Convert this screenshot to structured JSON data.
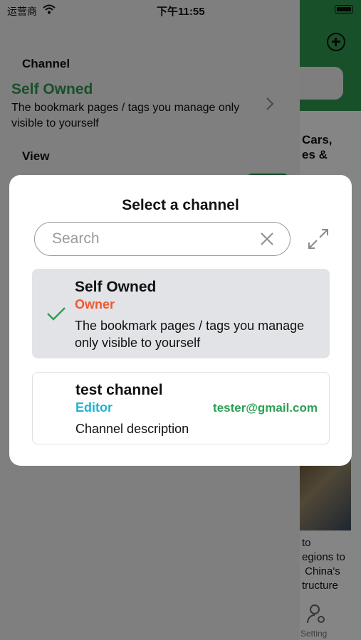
{
  "status_bar": {
    "carrier": "运营商",
    "time": "下午11:55"
  },
  "background": {
    "channel_section_label": "Channel",
    "current_channel_name": "Self Owned",
    "current_channel_desc": "The bookmark pages / tags you manage only visible to yourself",
    "view_section_label": "View",
    "article_snippet_top": "Cars,\nes &",
    "article_snippet_bottom": "to\negions to\n China's\ntructure",
    "tab_setting_label": "Setting"
  },
  "modal": {
    "title": "Select a channel",
    "search": {
      "placeholder": "Search",
      "value": ""
    },
    "channels": [
      {
        "name": "Self Owned",
        "role": "Owner",
        "role_color": "#f0582f",
        "description": "The bookmark pages / tags you manage only visible to yourself",
        "selected": true
      },
      {
        "name": "test channel",
        "role": "Editor",
        "role_color": "#1fb3d0",
        "email": "tester@gmail.com",
        "description": "Channel description",
        "selected": false
      }
    ]
  },
  "colors": {
    "brand_green": "#2e9a52",
    "check_green": "#2ba056"
  }
}
